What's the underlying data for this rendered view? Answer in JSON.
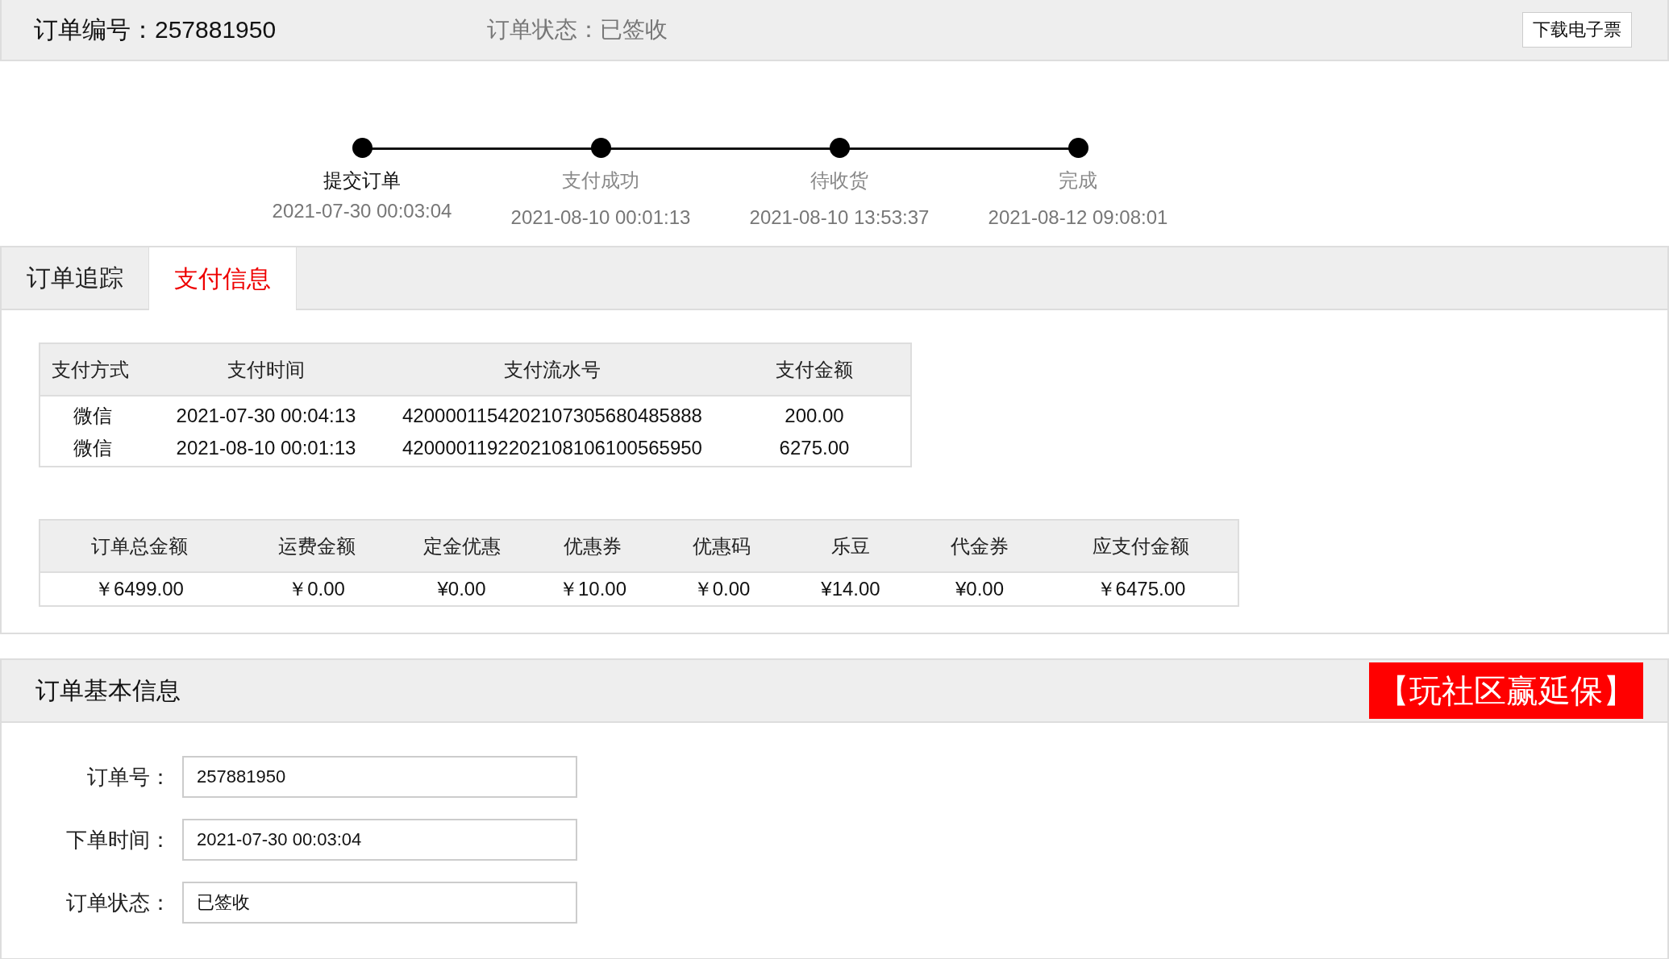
{
  "header": {
    "order_number": "订单编号：257881950",
    "status": "订单状态：已签收",
    "download_button": "下载电子票"
  },
  "steps": [
    {
      "label": "提交订单",
      "time": "2021-07-30 00:03:04",
      "current": true
    },
    {
      "label": "支付成功",
      "time": "2021-08-10 00:01:13",
      "current": false
    },
    {
      "label": "待收货",
      "time": "2021-08-10 13:53:37",
      "current": false
    },
    {
      "label": "完成",
      "time": "2021-08-12 09:08:01",
      "current": false
    }
  ],
  "tabs": [
    {
      "label": "订单追踪",
      "selected": false
    },
    {
      "label": "支付信息",
      "selected": true
    }
  ],
  "payments": {
    "columns": [
      "支付方式",
      "支付时间",
      "支付流水号",
      "支付金额"
    ],
    "rows": [
      [
        "微信",
        "2021-07-30 00:04:13",
        "4200001154202107305680485888",
        "200.00"
      ],
      [
        "微信",
        "2021-08-10 00:01:13",
        "4200001192202108106100565950",
        "6275.00"
      ]
    ]
  },
  "totals": {
    "columns": [
      "订单总金额",
      "运费金额",
      "定金优惠",
      "优惠券",
      "优惠码",
      "乐豆",
      "代金券",
      "应支付金额"
    ],
    "values": [
      "￥6499.00",
      "￥0.00",
      "¥0.00",
      "￥10.00",
      "￥0.00",
      "¥14.00",
      "¥0.00",
      "￥6475.00"
    ]
  },
  "info": {
    "title": "订单基本信息",
    "promo": "【玩社区赢延保】",
    "fields": [
      {
        "label": "订单号：",
        "value": "257881950"
      },
      {
        "label": "下单时间：",
        "value": "2021-07-30 00:03:04"
      },
      {
        "label": "订单状态：",
        "value": "已签收"
      }
    ]
  }
}
